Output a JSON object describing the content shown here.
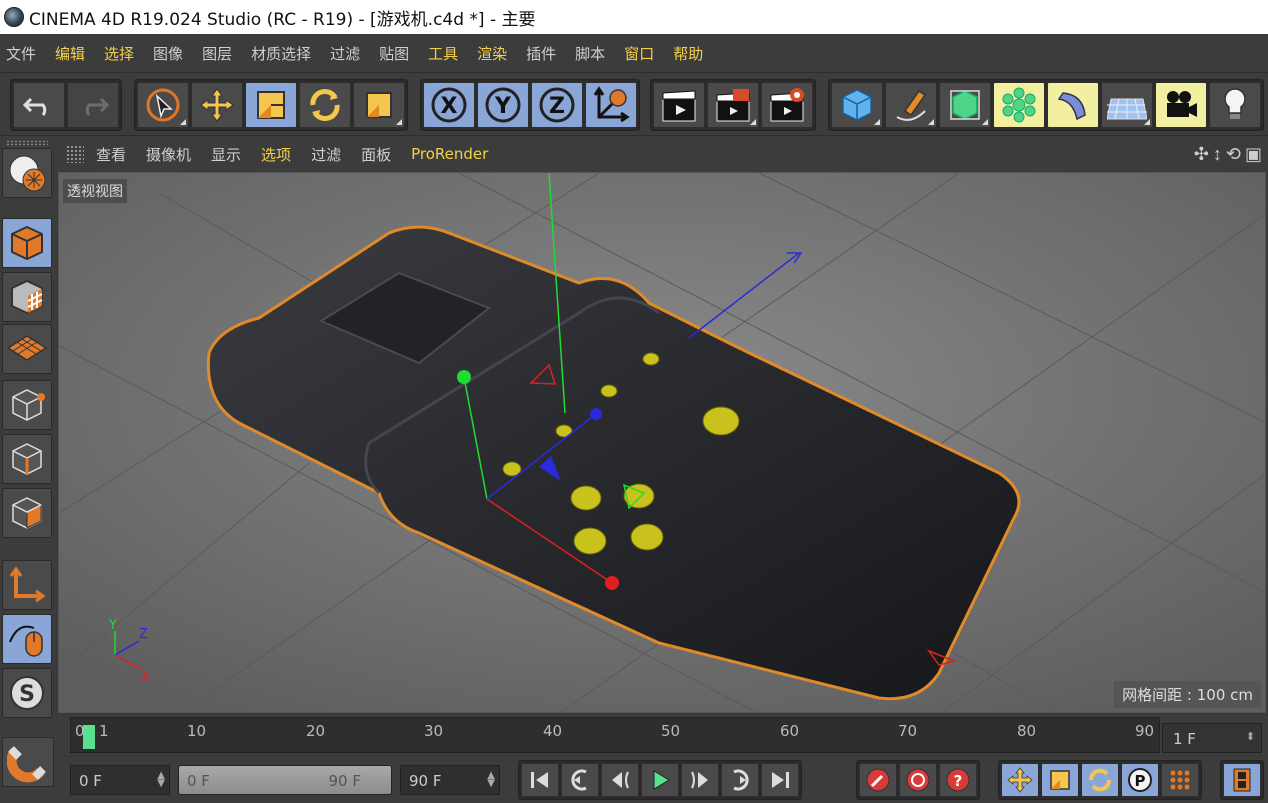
{
  "window": {
    "title": "CINEMA 4D R19.024 Studio (RC - R19) - [游戏机.c4d *] - 主要"
  },
  "menu": [
    "文件",
    "编辑",
    "选择",
    "图像",
    "图层",
    "材质选择",
    "过滤",
    "贴图",
    "工具",
    "渲染",
    "插件",
    "脚本",
    "窗口",
    "帮助"
  ],
  "viewport_menu": [
    "查看",
    "摄像机",
    "显示",
    "选项",
    "过滤",
    "面板",
    "ProRender"
  ],
  "viewport": {
    "label": "透视视图",
    "grid_spacing": "网格间距 : 100 cm",
    "axis_labels": {
      "y": "Y",
      "z": "Z",
      "x": "X"
    }
  },
  "toolbar": {
    "axis_x": "X",
    "axis_y": "Y",
    "axis_z": "Z",
    "colors": {
      "active": "#8aa6d6",
      "accent": "#f3d14a",
      "playhead": "#58e08f"
    }
  },
  "timeline": {
    "ticks": [
      "0",
      "1",
      "10",
      "20",
      "30",
      "40",
      "50",
      "60",
      "70",
      "80",
      "90"
    ],
    "fps": "1 F"
  },
  "bottom": {
    "current_frame": "0 F",
    "range_start": "0 F",
    "range_end": "90 F",
    "max_frame": "90 F",
    "pos_label": "P"
  }
}
